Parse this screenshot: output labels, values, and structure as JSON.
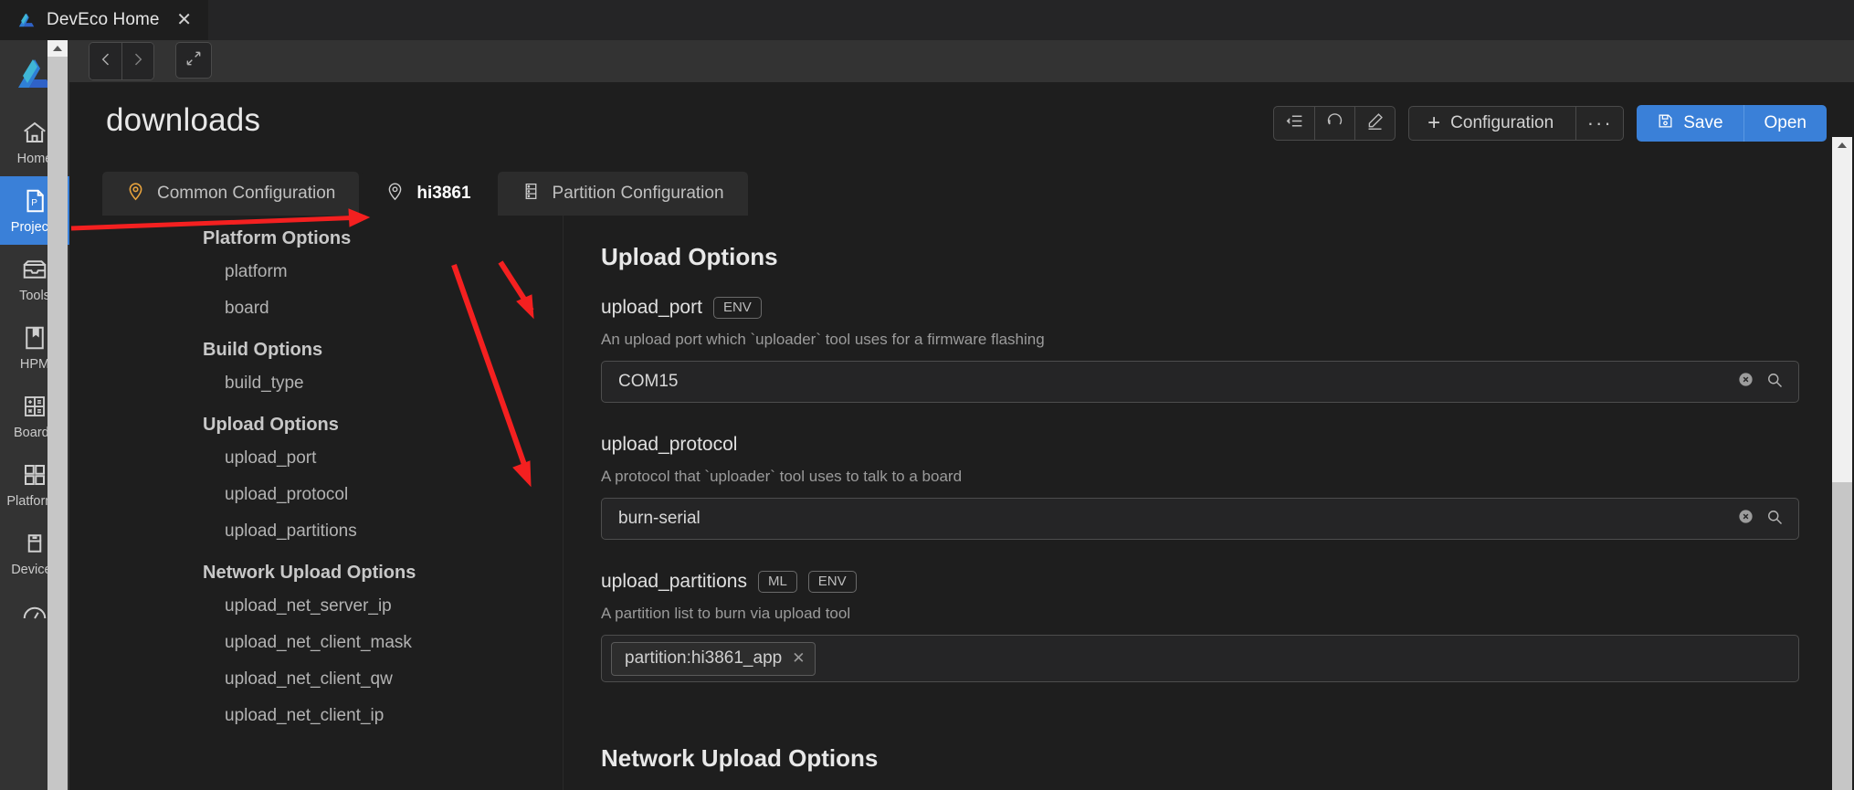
{
  "window": {
    "tab_title": "DevEco Home",
    "tab_icon": "deveco-logo-icon",
    "close_label": "✕"
  },
  "activity_bar": {
    "items": [
      {
        "label": "Home",
        "icon": "home-icon",
        "active": false
      },
      {
        "label": "Projects",
        "icon": "project-file-icon",
        "active": true
      },
      {
        "label": "Tools",
        "icon": "toolbox-icon",
        "active": false
      },
      {
        "label": "HPM",
        "icon": "bookmark-book-icon",
        "active": false
      },
      {
        "label": "Boards",
        "icon": "calculator-icon",
        "active": false
      },
      {
        "label": "Platforms",
        "icon": "grid-squares-icon",
        "active": false
      },
      {
        "label": "Devices",
        "icon": "usb-device-icon",
        "active": false
      },
      {
        "label": "",
        "icon": "gauge-icon",
        "active": false
      }
    ]
  },
  "nav": {
    "back_icon": "chevron-left-icon",
    "forward_icon": "chevron-right-icon",
    "expand_icon": "expand-diagonal-icon"
  },
  "header": {
    "title": "downloads"
  },
  "toolbar": {
    "icon_buttons": [
      {
        "name": "collapse-list-icon",
        "title": "collapse"
      },
      {
        "name": "undo-circle-icon",
        "title": "reset"
      },
      {
        "name": "pencil-edit-icon",
        "title": "edit"
      }
    ],
    "configuration_label": "Configuration",
    "configuration_plus": "+",
    "more_label": "···",
    "save_label": "Save",
    "save_icon": "floppy-save-icon",
    "open_label": "Open",
    "accent_color": "#3a80d8"
  },
  "tabs": [
    {
      "label": "Common Configuration",
      "icon": "map-pin-icon",
      "icon_color": "#e8a33d",
      "active": false
    },
    {
      "label": "hi3861",
      "icon": "map-pin-icon",
      "icon_color": "#cccccc",
      "active": true
    },
    {
      "label": "Partition Configuration",
      "icon": "server-list-icon",
      "icon_color": "#cccccc",
      "active": false
    }
  ],
  "tree": [
    {
      "type": "group",
      "label": "Platform Options"
    },
    {
      "type": "leaf",
      "label": "platform"
    },
    {
      "type": "leaf",
      "label": "board"
    },
    {
      "type": "group",
      "label": "Build Options"
    },
    {
      "type": "leaf",
      "label": "build_type"
    },
    {
      "type": "group",
      "label": "Upload Options"
    },
    {
      "type": "leaf",
      "label": "upload_port"
    },
    {
      "type": "leaf",
      "label": "upload_protocol"
    },
    {
      "type": "leaf",
      "label": "upload_partitions"
    },
    {
      "type": "group",
      "label": "Network Upload Options"
    },
    {
      "type": "leaf",
      "label": "upload_net_server_ip"
    },
    {
      "type": "leaf",
      "label": "upload_net_client_mask"
    },
    {
      "type": "leaf",
      "label": "upload_net_client_qw"
    },
    {
      "type": "leaf",
      "label": "upload_net_client_ip"
    }
  ],
  "detail": {
    "section_title": "Upload Options",
    "fields": [
      {
        "name": "upload_port",
        "badges": [
          "ENV"
        ],
        "description": "An upload port which `uploader` tool uses for a firmware flashing",
        "control": "input",
        "value": "COM15",
        "clear_icon": "clear-circle-icon",
        "search_icon": "search-icon"
      },
      {
        "name": "upload_protocol",
        "badges": [],
        "description": "A protocol that `uploader` tool uses to talk to a board",
        "control": "input",
        "value": "burn-serial",
        "clear_icon": "clear-circle-icon",
        "search_icon": "search-icon"
      },
      {
        "name": "upload_partitions",
        "badges": [
          "ML",
          "ENV"
        ],
        "description": "A partition list to burn via upload tool",
        "control": "chips",
        "chips": [
          {
            "label": "partition:hi3861_app",
            "remove": "✕"
          }
        ]
      }
    ],
    "next_section_title": "Network Upload Options"
  },
  "annotations": {
    "arrow_color": "#f42020",
    "arrows": [
      {
        "name": "arrow-to-hi3861-tab"
      },
      {
        "name": "arrow-to-upload-port"
      },
      {
        "name": "arrow-to-upload-protocol"
      }
    ]
  },
  "scrollbars": {
    "activity_bar_up_arrow": "▲",
    "content_up_arrow": "▲"
  }
}
